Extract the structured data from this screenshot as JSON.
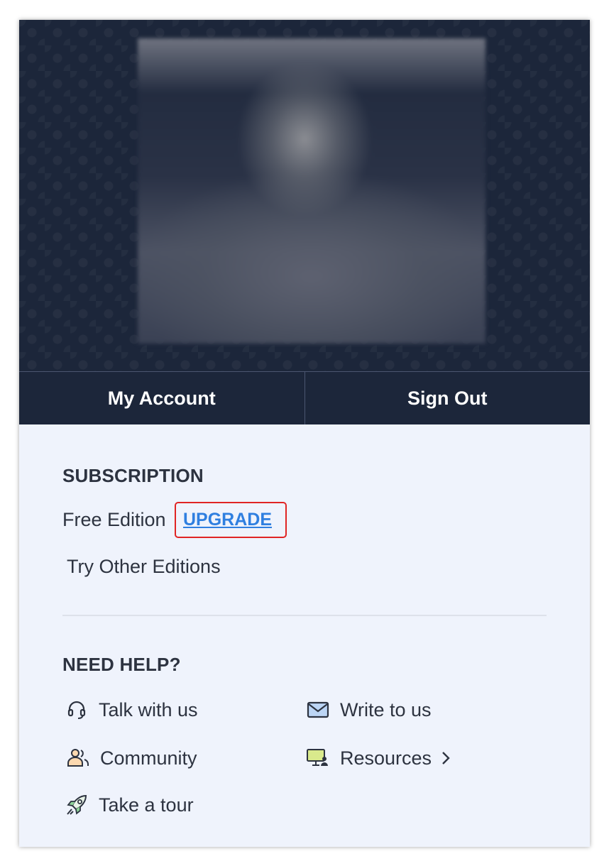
{
  "buttons": {
    "my_account": "My Account",
    "sign_out": "Sign Out"
  },
  "subscription": {
    "title": "SUBSCRIPTION",
    "edition": "Free Edition",
    "upgrade": "UPGRADE",
    "try_other": "Try Other Editions"
  },
  "help": {
    "title": "NEED HELP?",
    "items": [
      {
        "label": "Talk with us",
        "icon": "headset-icon"
      },
      {
        "label": "Write to us",
        "icon": "mail-icon"
      },
      {
        "label": "Community",
        "icon": "users-icon"
      },
      {
        "label": "Resources",
        "icon": "monitor-user-icon"
      },
      {
        "label": "Take a tour",
        "icon": "rocket-icon"
      }
    ]
  },
  "colors": {
    "header_bg": "#1c263a",
    "panel_bg": "#eff3fc",
    "link": "#2f7fe0",
    "highlight": "#e02424",
    "text": "#2d3340"
  }
}
